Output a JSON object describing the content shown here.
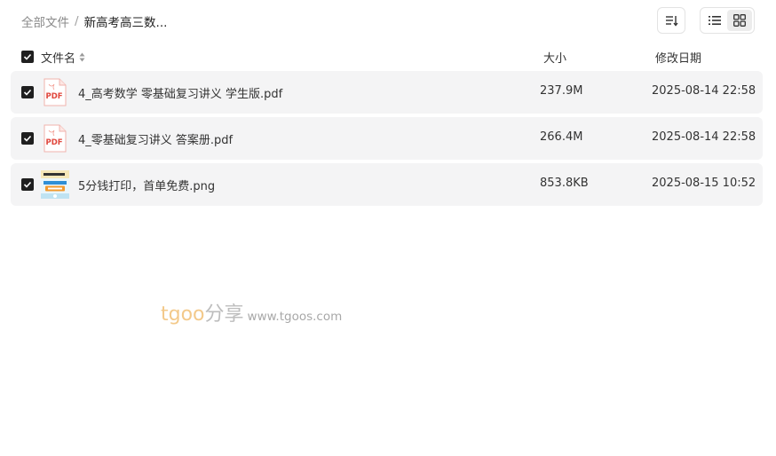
{
  "breadcrumb": {
    "root": "全部文件",
    "separator": "/",
    "current": "新高考高三数..."
  },
  "toolbar": {
    "sort_icon": "sort-icon",
    "list_view_icon": "list-view-icon",
    "grid_view_icon": "grid-view-icon",
    "active_view": "grid"
  },
  "table": {
    "columns": {
      "name": "文件名",
      "size": "大小",
      "date": "修改日期"
    },
    "all_checked": true,
    "rows": [
      {
        "name": "4_高考数学 零基础复习讲义 学生版.pdf",
        "size": "237.9M",
        "date": "2025-08-14 22:58",
        "type": "pdf",
        "icon_label": "PDF",
        "checked": true
      },
      {
        "name": "4_零基础复习讲义 答案册.pdf",
        "size": "266.4M",
        "date": "2025-08-14 22:58",
        "type": "pdf",
        "icon_label": "PDF",
        "checked": true
      },
      {
        "name": "5分钱打印，首单免费.png",
        "size": "853.8KB",
        "date": "2025-08-15 10:52",
        "type": "image",
        "checked": true
      }
    ]
  },
  "watermark": {
    "brand": "tgoo",
    "cn": "分享",
    "url": "www.tgoos.com"
  },
  "colors": {
    "row_bg": "#f4f4f5",
    "pdf_red": "#e0463c",
    "checkbox": "#1f1f1f",
    "watermark_brand": "#f3c98a"
  }
}
